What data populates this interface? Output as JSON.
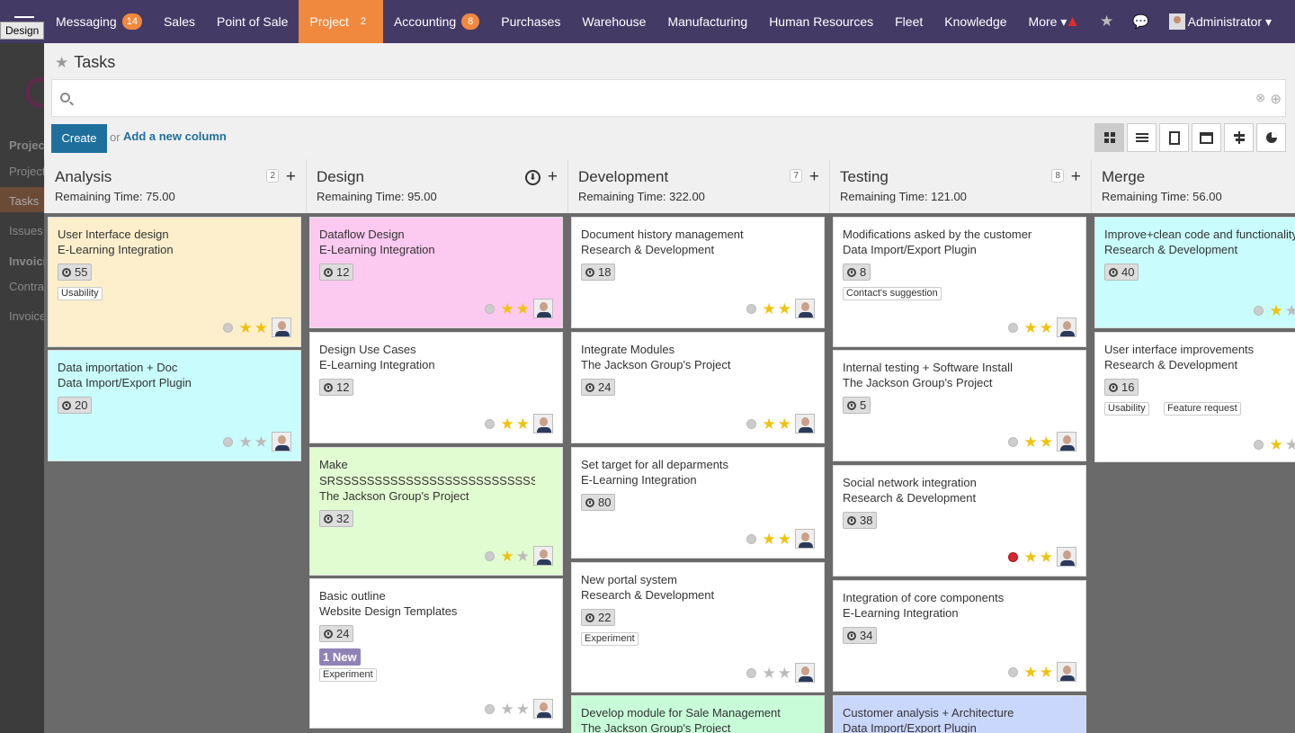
{
  "design_tag": "Design",
  "topbar": {
    "menu": [
      {
        "label": "Messaging",
        "badge": "14",
        "active": false
      },
      {
        "label": "Sales",
        "badge": "",
        "active": false
      },
      {
        "label": "Point of Sale",
        "badge": "",
        "active": false
      },
      {
        "label": "Project",
        "badge": "2",
        "active": true
      },
      {
        "label": "Accounting",
        "badge": "8",
        "active": false
      },
      {
        "label": "Purchases",
        "badge": "",
        "active": false
      },
      {
        "label": "Warehouse",
        "badge": "",
        "active": false
      },
      {
        "label": "Manufacturing",
        "badge": "",
        "active": false
      },
      {
        "label": "Human Resources",
        "badge": "",
        "active": false
      },
      {
        "label": "Fleet",
        "badge": "",
        "active": false
      },
      {
        "label": "Knowledge",
        "badge": "",
        "active": false
      },
      {
        "label": "More ▾",
        "badge": "",
        "active": false
      }
    ],
    "user": "Administrator ▾",
    "icons": [
      "warning-icon",
      "star-icon",
      "chat-icon"
    ]
  },
  "leftpane": {
    "items": [
      "Project",
      "Projects",
      "Tasks",
      "Issues",
      "Invoicing",
      "Contracts",
      "Invoices"
    ]
  },
  "header": {
    "title": "Tasks",
    "search_placeholder": "",
    "create_label": "Create",
    "or_label": "or",
    "add_column_label": "Add a new column"
  },
  "columns": [
    {
      "title": "Analysis",
      "remaining": "Remaining Time: 75.00",
      "count": "2"
    },
    {
      "title": "Design",
      "remaining": "Remaining Time: 95.00",
      "count": ""
    },
    {
      "title": "Development",
      "remaining": "Remaining Time: 322.00",
      "count": "7"
    },
    {
      "title": "Testing",
      "remaining": "Remaining Time: 121.00",
      "count": "8"
    },
    {
      "title": "Merge",
      "remaining": "Remaining Time: 56.00",
      "count": ""
    }
  ],
  "cards": [
    [
      {
        "name": "User Interface design",
        "project": "E-Learning Integration",
        "hours": "55",
        "tags": [
          "Usability"
        ],
        "color": "yellow",
        "stars": 2,
        "dot": "grey"
      },
      {
        "name": "Data importation + Doc",
        "project": "Data Import/Export Plugin",
        "hours": "20",
        "tags": [],
        "color": "cyan",
        "stars": 0,
        "dot": "grey"
      }
    ],
    [
      {
        "name": "Dataflow Design",
        "project": "E-Learning Integration",
        "hours": "12",
        "tags": [],
        "color": "pink",
        "stars": 2,
        "dot": "grey"
      },
      {
        "name": "Design Use Cases",
        "project": "E-Learning Integration",
        "hours": "12",
        "tags": [],
        "color": "white",
        "stars": 2,
        "dot": "grey"
      },
      {
        "name": "Make SRSSSSSSSSSSSSSSSSSSSSSSSSSS",
        "project": "The Jackson Group's Project",
        "hours": "32",
        "tags": [],
        "color": "green",
        "stars": 1,
        "dot": "grey"
      },
      {
        "name": "Basic outline",
        "project": "Website Design Templates",
        "hours": "24",
        "tags": [
          "Experiment"
        ],
        "msg": "1 New",
        "color": "white",
        "stars": 0,
        "dot": "grey"
      }
    ],
    [
      {
        "name": "Document history management",
        "project": "Research & Development",
        "hours": "18",
        "tags": [],
        "color": "white",
        "stars": 2,
        "dot": "grey"
      },
      {
        "name": "Integrate Modules",
        "project": "The Jackson Group's Project",
        "hours": "24",
        "tags": [],
        "color": "white",
        "stars": 2,
        "dot": "grey"
      },
      {
        "name": "Set target for all deparments",
        "project": "E-Learning Integration",
        "hours": "80",
        "tags": [],
        "color": "white",
        "stars": 2,
        "dot": "grey"
      },
      {
        "name": "New portal system",
        "project": "Research & Development",
        "hours": "22",
        "tags": [
          "Experiment"
        ],
        "color": "white",
        "stars": 0,
        "dot": "grey"
      },
      {
        "name": "Develop module for Sale Management",
        "project": "The Jackson Group's Project",
        "hours": "",
        "tags": [],
        "color": "mint",
        "stars": 0,
        "dot": "grey"
      }
    ],
    [
      {
        "name": "Modifications asked by the customer",
        "project": "Data Import/Export Plugin",
        "hours": "8",
        "tags": [
          "Contact's suggestion"
        ],
        "color": "white",
        "stars": 2,
        "dot": "grey"
      },
      {
        "name": "Internal testing + Software Install",
        "project": "The Jackson Group's Project",
        "hours": "5",
        "tags": [],
        "color": "white",
        "stars": 2,
        "dot": "grey"
      },
      {
        "name": "Social network integration",
        "project": "Research & Development",
        "hours": "38",
        "tags": [],
        "color": "white",
        "stars": 2,
        "dot": "red"
      },
      {
        "name": "Integration of core components",
        "project": "E-Learning Integration",
        "hours": "34",
        "tags": [],
        "color": "white",
        "stars": 2,
        "dot": "grey"
      },
      {
        "name": "Customer analysis + Architecture",
        "project": "Data Import/Export Plugin",
        "hours": "",
        "tags": [],
        "color": "blue",
        "stars": 0,
        "dot": "grey"
      }
    ],
    [
      {
        "name": "Improve+clean code and functionality",
        "project": "Research & Development",
        "hours": "40",
        "tags": [],
        "color": "cyan",
        "stars": 1,
        "dot": "grey"
      },
      {
        "name": "User interface improvements",
        "project": "Research & Development",
        "hours": "16",
        "tags": [
          "Usability",
          "Feature request"
        ],
        "color": "white",
        "stars": 1,
        "dot": "grey"
      }
    ]
  ]
}
